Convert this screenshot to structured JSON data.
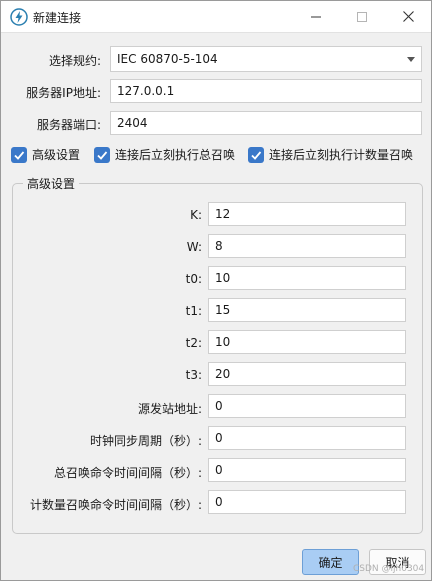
{
  "window": {
    "title": "新建连接"
  },
  "form": {
    "protocol": {
      "label": "选择规约:",
      "value": "IEC 60870-5-104"
    },
    "ip": {
      "label": "服务器IP地址:",
      "value": "127.0.0.1"
    },
    "port": {
      "label": "服务器端口:",
      "value": "2404"
    }
  },
  "checkboxes": [
    {
      "label": "高级设置",
      "checked": true
    },
    {
      "label": "连接后立刻执行总召唤",
      "checked": true
    },
    {
      "label": "连接后立刻执行计数量召唤",
      "checked": true
    }
  ],
  "advanced": {
    "title": "高级设置",
    "rows": [
      {
        "label": "K:",
        "value": "12"
      },
      {
        "label": "W:",
        "value": "8"
      },
      {
        "label": "t0:",
        "value": "10"
      },
      {
        "label": "t1:",
        "value": "15"
      },
      {
        "label": "t2:",
        "value": "10"
      },
      {
        "label": "t3:",
        "value": "20"
      },
      {
        "label": "源发站地址:",
        "value": "0"
      },
      {
        "label": "时钟同步周期（秒）:",
        "value": "0"
      },
      {
        "label": "总召唤命令时间间隔（秒）:",
        "value": "0"
      },
      {
        "label": "计数量召唤命令时间间隔（秒）:",
        "value": "0"
      }
    ]
  },
  "buttons": {
    "ok": "确定",
    "cancel": "取消"
  },
  "watermark": "CSDN @ljh0304",
  "colors": {
    "accent": "#3a78c9",
    "primary_button": "#a9cdf4"
  }
}
